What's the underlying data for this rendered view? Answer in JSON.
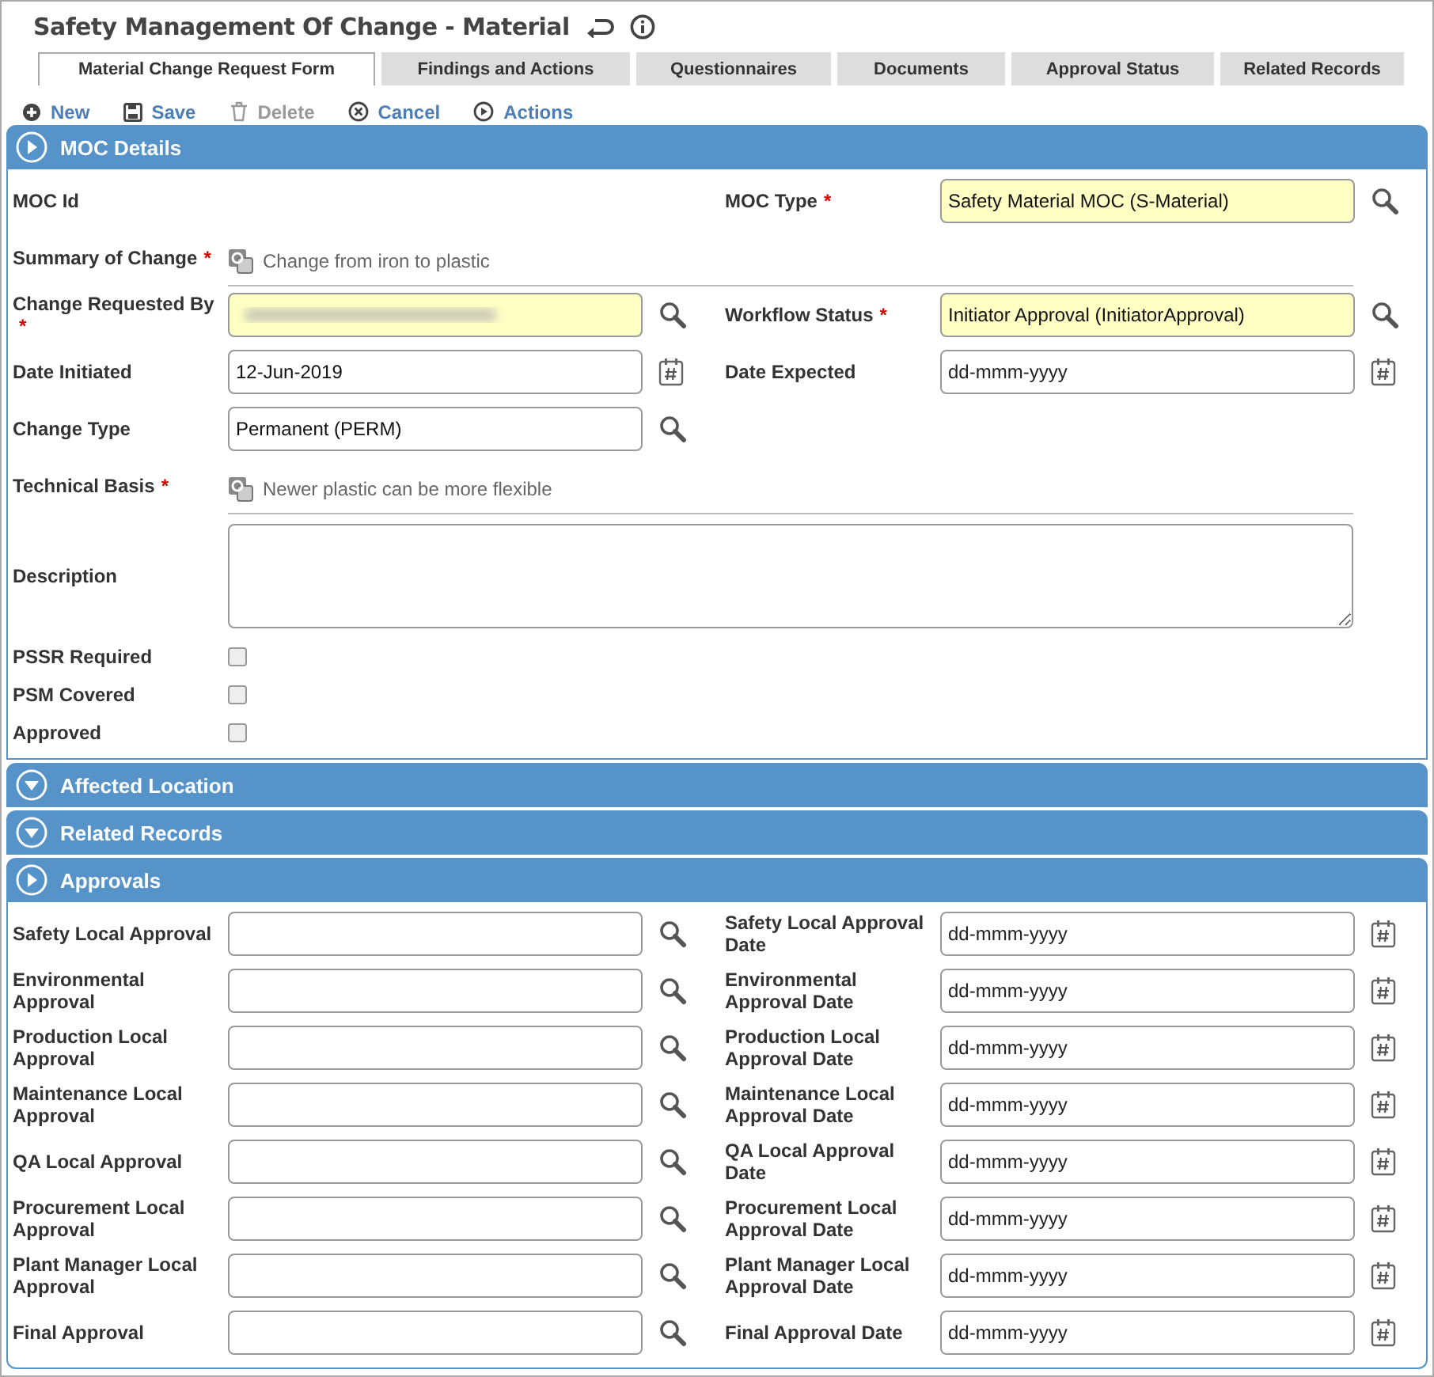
{
  "title": "Safety Management Of Change - Material",
  "tabs": [
    {
      "label": "Material Change Request Form",
      "selected": true
    },
    {
      "label": "Findings and Actions",
      "selected": false
    },
    {
      "label": "Questionnaires",
      "selected": false
    },
    {
      "label": "Documents",
      "selected": false
    },
    {
      "label": "Approval Status",
      "selected": false
    },
    {
      "label": "Related Records",
      "selected": false
    }
  ],
  "toolbar": [
    {
      "label": "New",
      "kind": "new",
      "disabled": false
    },
    {
      "label": "Save",
      "kind": "save",
      "disabled": false
    },
    {
      "label": "Delete",
      "kind": "delete",
      "disabled": true
    },
    {
      "label": "Cancel",
      "kind": "cancel",
      "disabled": false
    },
    {
      "label": "Actions",
      "kind": "actions",
      "disabled": false
    }
  ],
  "sections": [
    {
      "title": "MOC Details",
      "expanded": true,
      "rows": [
        {
          "fields": [
            {
              "kind": "readonly",
              "label": "MOC Id"
            },
            {
              "kind": "lookup",
              "label": "MOC Type",
              "required_mark": "*",
              "highlighted": true,
              "value": "Safety Material MOC (S-Material)"
            }
          ]
        },
        {
          "fields": [
            {
              "kind": "note",
              "label": "Summary of Change",
              "required_mark": "*",
              "value": "Change from iron to plastic"
            }
          ]
        },
        {
          "fields": [
            {
              "kind": "lookup",
              "label": "Change Requested By",
              "required_mark": "*",
              "highlighted": true,
              "blurred": true
            },
            {
              "kind": "lookup",
              "label": "Workflow Status",
              "required_mark": "*",
              "highlighted": true,
              "value": "Initiator Approval (InitiatorApproval)"
            }
          ]
        },
        {
          "fields": [
            {
              "kind": "date",
              "label": "Date Initiated",
              "value": "12-Jun-2019"
            },
            {
              "kind": "date",
              "label": "Date Expected",
              "placeholder": "dd-mmm-yyyy"
            }
          ]
        },
        {
          "fields": [
            {
              "kind": "lookup",
              "label": "Change Type",
              "value": "Permanent (PERM)"
            }
          ]
        },
        {
          "fields": [
            {
              "kind": "note",
              "label": "Technical Basis",
              "required_mark": "*",
              "value": "Newer plastic can be more flexible"
            }
          ]
        },
        {
          "fields": [
            {
              "kind": "textarea",
              "label": "Description"
            }
          ]
        },
        {
          "fields": [
            {
              "kind": "checkbox",
              "label": "PSSR Required",
              "checked": false
            }
          ]
        },
        {
          "fields": [
            {
              "kind": "checkbox",
              "label": "PSM Covered",
              "checked": false
            }
          ]
        },
        {
          "fields": [
            {
              "kind": "checkbox",
              "label": "Approved",
              "checked": false
            }
          ]
        }
      ]
    },
    {
      "title": "Affected Location",
      "expanded": false
    },
    {
      "title": "Related Records",
      "expanded": false
    },
    {
      "title": "Approvals",
      "expanded": true,
      "rows": [
        {
          "fields": [
            {
              "kind": "lookup",
              "label": "Safety Local Approval"
            },
            {
              "kind": "date",
              "label": "Safety Local Approval Date",
              "placeholder": "dd-mmm-yyyy"
            }
          ]
        },
        {
          "fields": [
            {
              "kind": "lookup",
              "label": "Environmental Approval"
            },
            {
              "kind": "date",
              "label": "Environmental Approval Date",
              "placeholder": "dd-mmm-yyyy"
            }
          ]
        },
        {
          "fields": [
            {
              "kind": "lookup",
              "label": "Production Local Approval"
            },
            {
              "kind": "date",
              "label": "Production Local Approval Date",
              "placeholder": "dd-mmm-yyyy"
            }
          ]
        },
        {
          "fields": [
            {
              "kind": "lookup",
              "label": "Maintenance Local Approval"
            },
            {
              "kind": "date",
              "label": "Maintenance Local Approval Date",
              "placeholder": "dd-mmm-yyyy"
            }
          ]
        },
        {
          "fields": [
            {
              "kind": "lookup",
              "label": "QA Local Approval"
            },
            {
              "kind": "date",
              "label": "QA Local Approval Date",
              "placeholder": "dd-mmm-yyyy"
            }
          ]
        },
        {
          "fields": [
            {
              "kind": "lookup",
              "label": "Procurement Local Approval"
            },
            {
              "kind": "date",
              "label": "Procurement Local Approval Date",
              "placeholder": "dd-mmm-yyyy"
            }
          ]
        },
        {
          "fields": [
            {
              "kind": "lookup",
              "label": "Plant Manager Local Approval"
            },
            {
              "kind": "date",
              "label": "Plant Manager Local Approval Date",
              "placeholder": "dd-mmm-yyyy"
            }
          ]
        },
        {
          "fields": [
            {
              "kind": "lookup",
              "label": "Final Approval"
            },
            {
              "kind": "date",
              "label": "Final Approval Date",
              "placeholder": "dd-mmm-yyyy"
            }
          ]
        }
      ]
    }
  ]
}
